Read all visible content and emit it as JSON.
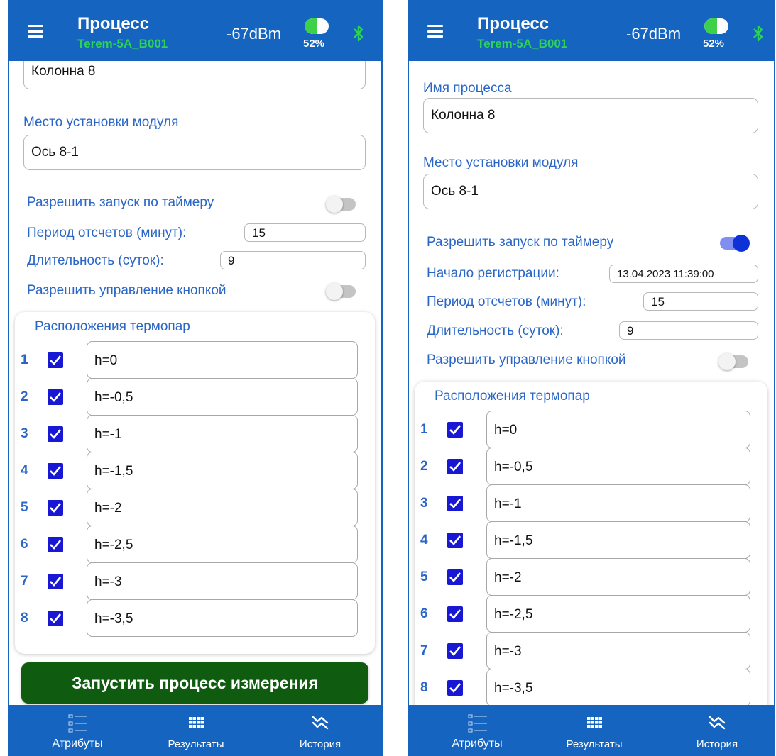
{
  "header": {
    "title": "Процесс",
    "device": "Terem-5A_B001",
    "signal": "-67dBm",
    "battery_percent": 52,
    "battery_label": "52%"
  },
  "left": {
    "process_name_value": "Колонна 8",
    "location_label": "Место установки модуля",
    "location_value": "Ось 8-1",
    "timer_label": "Разрешить запуск по таймеру",
    "timer_enabled": false,
    "period_label": "Период отсчетов (минут):",
    "period_value": "15",
    "duration_label": "Длительность (суток):",
    "duration_value": "9",
    "button_control_label": "Разрешить управление кнопкой",
    "button_control_enabled": false,
    "thermocouples_title": "Расположения термопар",
    "thermocouples": [
      {
        "num": "1",
        "checked": true,
        "value": "h=0"
      },
      {
        "num": "2",
        "checked": true,
        "value": "h=-0,5"
      },
      {
        "num": "3",
        "checked": true,
        "value": "h=-1"
      },
      {
        "num": "4",
        "checked": true,
        "value": "h=-1,5"
      },
      {
        "num": "5",
        "checked": true,
        "value": "h=-2"
      },
      {
        "num": "6",
        "checked": true,
        "value": "h=-2,5"
      },
      {
        "num": "7",
        "checked": true,
        "value": "h=-3"
      },
      {
        "num": "8",
        "checked": true,
        "value": "h=-3,5"
      }
    ],
    "start_button_label": "Запустить процесс измерения"
  },
  "right": {
    "process_name_label": "Имя процесса",
    "process_name_value": "Колонна 8",
    "location_label": "Место установки модуля",
    "location_value": "Ось 8-1",
    "timer_label": "Разрешить запуск по таймеру",
    "timer_enabled": true,
    "start_label": "Начало регистрации:",
    "start_value": "13.04.2023 11:39:00",
    "period_label": "Период отсчетов (минут):",
    "period_value": "15",
    "duration_label": "Длительность (суток):",
    "duration_value": "9",
    "button_control_label": "Разрешить управление кнопкой",
    "button_control_enabled": false,
    "thermocouples_title": "Расположения термопар",
    "thermocouples": [
      {
        "num": "1",
        "checked": true,
        "value": "h=0"
      },
      {
        "num": "2",
        "checked": true,
        "value": "h=-0,5"
      },
      {
        "num": "3",
        "checked": true,
        "value": "h=-1"
      },
      {
        "num": "4",
        "checked": true,
        "value": "h=-1,5"
      },
      {
        "num": "5",
        "checked": true,
        "value": "h=-2"
      },
      {
        "num": "6",
        "checked": true,
        "value": "h=-2,5"
      },
      {
        "num": "7",
        "checked": true,
        "value": "h=-3"
      },
      {
        "num": "8",
        "checked": true,
        "value": "h=-3,5"
      }
    ]
  },
  "nav": {
    "attributes": "Атрибуты",
    "results": "Результаты",
    "history": "История"
  },
  "icons": {
    "menu": "hamburger-icon",
    "bluetooth": "bluetooth-icon",
    "battery": "battery-icon",
    "attributes": "list-icon",
    "results": "grid-icon",
    "history": "zigzag-icon",
    "check": "checkbox-check-icon"
  },
  "colors": {
    "primary": "#1565c0",
    "accent_text": "#2a66c7",
    "device_green": "#2ed158",
    "battery_green": "#3fd04a",
    "checkbox": "#1717d4",
    "start_button": "#0f5b0f",
    "toggle_on": "#0e32d6"
  }
}
